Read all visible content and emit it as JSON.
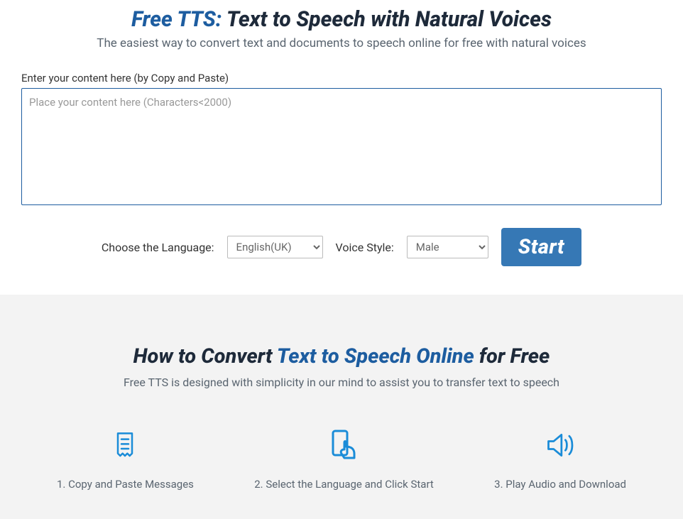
{
  "header": {
    "title_prefix": "Free TTS: ",
    "title_main": "Text to Speech with Natural Voices",
    "subtitle": "The easiest way to convert text and documents to speech online for free with natural voices"
  },
  "input": {
    "label": "Enter your content here (by Copy and Paste)",
    "placeholder": "Place your content here (Characters<2000)"
  },
  "controls": {
    "language_label": "Choose the Language:",
    "language_value": "English(UK)",
    "voice_label": "Voice Style:",
    "voice_value": "Male",
    "start_label": "Start"
  },
  "howto": {
    "title_before": "How to Convert ",
    "title_accent": "Text to Speech Online",
    "title_after": " for Free",
    "subtitle": "Free TTS is designed with simplicity in our mind to assist you to transfer text to speech",
    "steps": [
      {
        "label": "1. Copy and Paste Messages"
      },
      {
        "label": "2. Select the Language and Click Start"
      },
      {
        "label": "3. Play Audio and Download"
      }
    ]
  }
}
